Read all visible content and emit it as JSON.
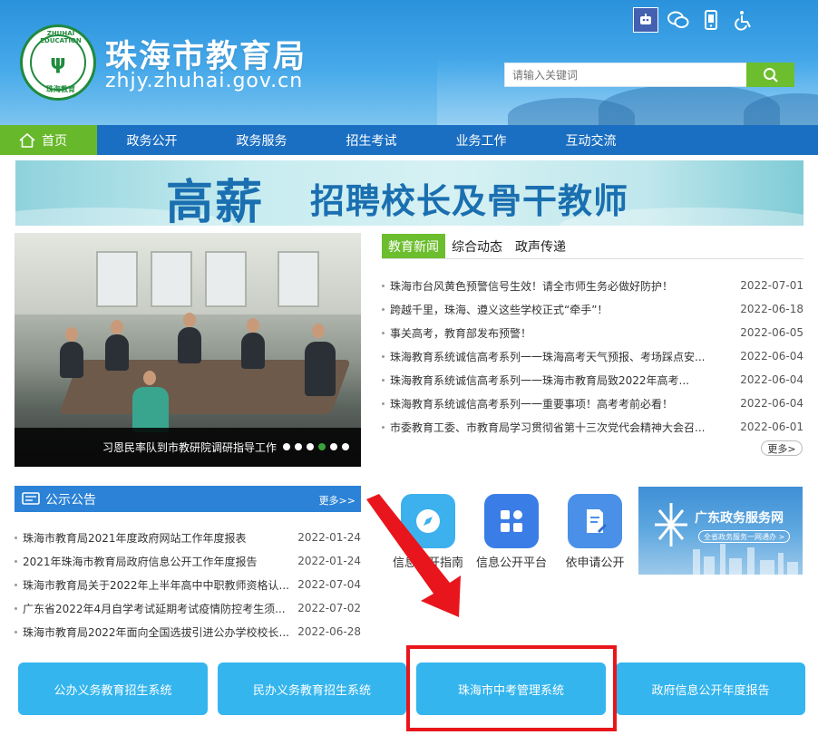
{
  "header": {
    "logo_text_top": "ZHUHAI EDUCATION",
    "logo_text_bottom": "珠海教育",
    "title": "珠海市教育局",
    "domain": "zhjy.zhuhai.gov.cn",
    "search_placeholder": "请输入关键词",
    "top_icon_names": [
      "robot-assistant-icon",
      "wechat-icon",
      "mobile-icon",
      "accessibility-icon"
    ]
  },
  "nav": {
    "items": [
      "首页",
      "政务公开",
      "政务服务",
      "招生考试",
      "业务工作",
      "互动交流"
    ]
  },
  "banner": {
    "big": "高薪",
    "sub": "招聘校长及骨干教师"
  },
  "slide": {
    "caption": "习恩民率队到市教研院调研指导工作"
  },
  "news": {
    "tabs": [
      "教育新闻",
      "综合动态",
      "政声传递"
    ],
    "items": [
      {
        "title": "珠海市台风黄色预警信号生效！请全市师生务必做好防护！",
        "date": "2022-07-01"
      },
      {
        "title": "跨越千里，珠海、遵义这些学校正式“牵手”！",
        "date": "2022-06-18"
      },
      {
        "title": "事关高考，教育部发布预警！",
        "date": "2022-06-05"
      },
      {
        "title": "珠海教育系统诚信高考系列一一珠海高考天气预报、考场踩点安...",
        "date": "2022-06-04"
      },
      {
        "title": "珠海教育系统诚信高考系列一一珠海市教育局致2022年高考...",
        "date": "2022-06-04"
      },
      {
        "title": "珠海教育系统诚信高考系列一一重要事项！高考考前必看！",
        "date": "2022-06-04"
      },
      {
        "title": "市委教育工委、市教育局学习贯彻省第十三次党代会精神大会召...",
        "date": "2022-06-01"
      }
    ],
    "more": "更多>"
  },
  "notice": {
    "title": "公示公告",
    "more": "更多>>",
    "items": [
      {
        "title": "珠海市教育局2021年度政府网站工作年度报表",
        "date": "2022-01-24"
      },
      {
        "title": "2021年珠海市教育局政府信息公开工作年度报告",
        "date": "2022-01-24"
      },
      {
        "title": "珠海市教育局关于2022年上半年高中中职教师资格认...",
        "date": "2022-07-04"
      },
      {
        "title": "广东省2022年4月自学考试延期考试疫情防控考生须...",
        "date": "2022-07-02"
      },
      {
        "title": "珠海市教育局2022年面向全国选拔引进公办学校校长...",
        "date": "2022-06-28"
      }
    ]
  },
  "apps": [
    {
      "label": "信息公开指南",
      "icon": "compass-icon",
      "color": "#3db1ee"
    },
    {
      "label": "信息公开平台",
      "icon": "grid-icon",
      "color": "#3b7de6"
    },
    {
      "label": "依申请公开",
      "icon": "document-pen-icon",
      "color": "#4a90e8"
    }
  ],
  "gd_service": {
    "title": "广东政务服务网",
    "sub": "全省政务服务一网通办 >"
  },
  "systems": [
    "公办义务教育招生系统",
    "民办义务教育招生系统",
    "珠海市中考管理系统",
    "政府信息公开年度报告"
  ],
  "colors": {
    "nav_blue": "#1b6fc2",
    "accent_green": "#6cbe2e",
    "button_cyan": "#34b5ee",
    "highlight_red": "#e8161c"
  }
}
